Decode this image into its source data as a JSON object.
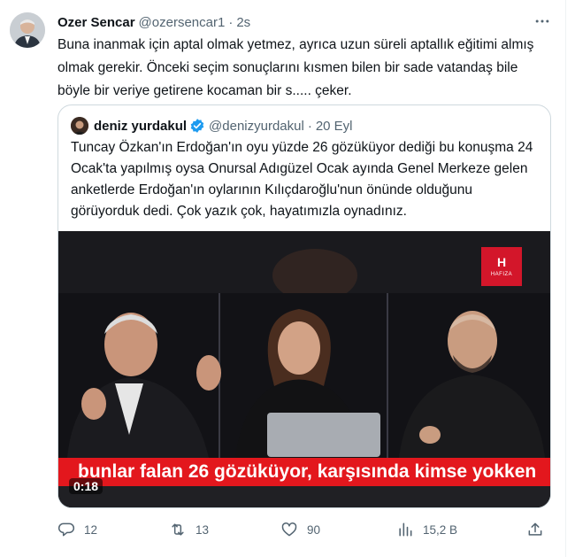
{
  "tweet": {
    "author_name": "Ozer Sencar",
    "author_handle": "@ozersencar1",
    "separator": "·",
    "time": "2s",
    "text": "Buna inanmak için aptal olmak yetmez, ayrıca uzun süreli aptallık eğitimi almış olmak gerekir. Önceki seçim sonuçlarını kısmen bilen bir sade vatandaş bile böyle bir veriye getirene kocaman bir s..... çeker."
  },
  "quoted": {
    "author_name": "deniz yurdakul",
    "author_handle": "@denizyurdakul",
    "separator": "·",
    "date": "20 Eyl",
    "text": "Tuncay Özkan'ın Erdoğan'ın oyu yüzde 26 gözüküyor dediği bu konuşma 24 Ocak'ta yapılmış oysa Onursal Adıgüzel Ocak ayında Genel Merkeze gelen anketlerde Erdoğan'ın oylarının Kılıçdaroğlu'nun önünde olduğunu görüyorduk dedi. Çok yazık çok, hayatımızla oynadınız.",
    "video": {
      "caption": "bunlar falan 26 gözüküyor, karşısında kimse yokken",
      "duration": "0:18",
      "channel_logo": "H",
      "channel_logo_sub": "HAFIZA"
    }
  },
  "actions": {
    "replies": "12",
    "retweets": "13",
    "likes": "90",
    "views": "15,2 B"
  },
  "colors": {
    "caption_bg": "#e3171d",
    "verified": "#1d9bf0",
    "secondary_text": "#536471"
  },
  "icons": [
    "more-icon",
    "verified-icon",
    "reply-icon",
    "retweet-icon",
    "like-icon",
    "views-icon",
    "share-icon"
  ]
}
